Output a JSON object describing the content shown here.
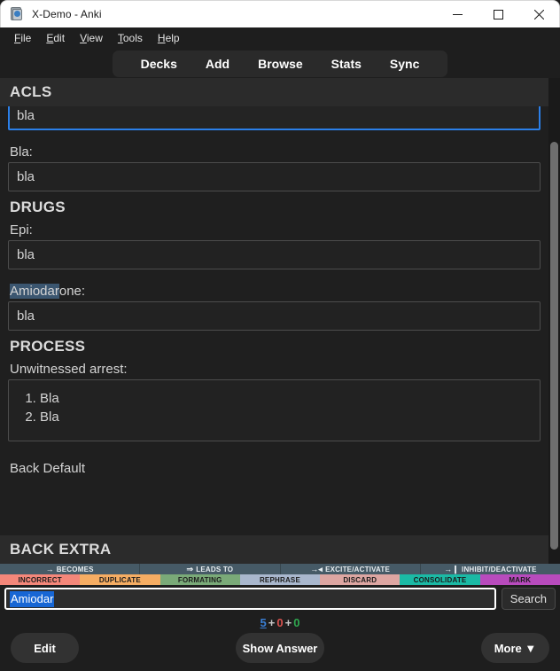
{
  "window": {
    "title": "X-Demo - Anki",
    "app_icon": "anki-card-icon",
    "minimize": "minimize-icon",
    "maximize": "maximize-icon",
    "close": "close-icon"
  },
  "menubar": {
    "items": [
      {
        "label": "File",
        "mnemonic": "F"
      },
      {
        "label": "Edit",
        "mnemonic": "E"
      },
      {
        "label": "View",
        "mnemonic": "V"
      },
      {
        "label": "Tools",
        "mnemonic": "T"
      },
      {
        "label": "Help",
        "mnemonic": "H"
      }
    ]
  },
  "navbar": {
    "buttons": [
      "Decks",
      "Add",
      "Browse",
      "Stats",
      "Sync"
    ]
  },
  "card": {
    "sticky_top_heading": "ACLS",
    "sticky_bottom_heading": "BACK EXTRA",
    "clipped_top_label": "Bla:",
    "clipped_bottom_label": "Back Default",
    "sections": [
      {
        "heading": "",
        "fields": [
          {
            "label": "",
            "value": "bla",
            "focused": true
          },
          {
            "label": "Bla:",
            "value": "bla",
            "focused": false
          }
        ]
      },
      {
        "heading": "DRUGS",
        "fields": [
          {
            "label": "Epi:",
            "value": "bla",
            "focused": false
          },
          {
            "label": "Amiodarone:",
            "label_highlight": "Amiodar",
            "label_rest": "one:",
            "value": "bla",
            "focused": false
          }
        ]
      },
      {
        "heading": "PROCESS",
        "fields": [
          {
            "label": "Unwitnessed arrest:",
            "list": [
              "Bla",
              "Bla"
            ],
            "focused": false
          }
        ]
      }
    ]
  },
  "tagbar": {
    "relations": [
      {
        "label": "BECOMES",
        "arrow": "→"
      },
      {
        "label": "LEADS TO",
        "arrow": "⇒"
      },
      {
        "label": "EXCITE/ACTIVATE",
        "arrow": "→◂"
      },
      {
        "label": "INHIBIT/DEACTIVATE",
        "arrow": "→❙"
      }
    ],
    "actions": [
      {
        "label": "INCORRECT",
        "color": "#f4877a"
      },
      {
        "label": "DUPLICATE",
        "color": "#f5ad63"
      },
      {
        "label": "FORMATING",
        "color": "#7aaa78"
      },
      {
        "label": "REPHRASE",
        "color": "#a9b7cd"
      },
      {
        "label": "DISCARD",
        "color": "#dda6a2"
      },
      {
        "label": "CONSOLIDATE",
        "color": "#1bbaa5"
      },
      {
        "label": "MARK",
        "color": "#b84bbd"
      }
    ]
  },
  "search": {
    "value": "Amiodar",
    "placeholder": "",
    "button_label": "Search"
  },
  "bottom": {
    "counts": {
      "new": "5",
      "learning": "0",
      "review": "0",
      "separator": "+"
    },
    "edit_label": "Edit",
    "show_answer_label": "Show Answer",
    "more_label": "More ▼"
  },
  "colors": {
    "accent_blue": "#2b7fe8",
    "selection_blue": "#1766d4",
    "highlight_slate": "#3b5670",
    "count_new": "#3a7fd5",
    "count_learning": "#d9534f",
    "count_review": "#2fa84f",
    "tagbar_top_bg": "#465a66"
  }
}
